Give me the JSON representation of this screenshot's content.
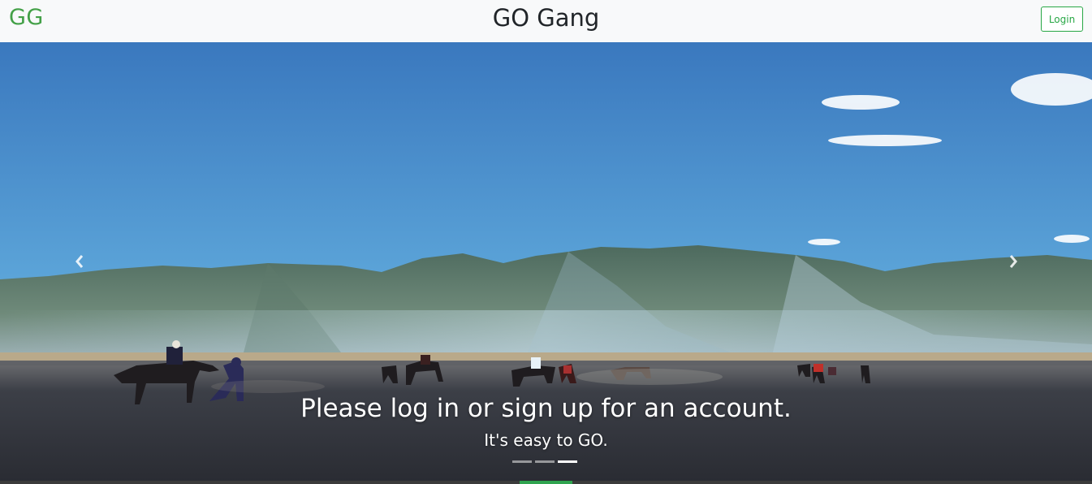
{
  "navbar": {
    "brand": "GG",
    "title": "GO Gang",
    "login_label": "Login"
  },
  "carousel": {
    "heading": "Please log in or sign up for an account.",
    "subheading": "It's easy to GO.",
    "prev_icon": "chevron-left-icon",
    "next_icon": "chevron-right-icon",
    "slide_count": 3,
    "active_slide": 3,
    "image_description": "Mountain valley with horse riders on dark sand under a blue sky"
  },
  "colors": {
    "brand": "#43a047",
    "login_border": "#28a745",
    "sky_top": "#3a78be",
    "sky_bottom": "#7cc3e6",
    "sand": "#3a3d45"
  }
}
